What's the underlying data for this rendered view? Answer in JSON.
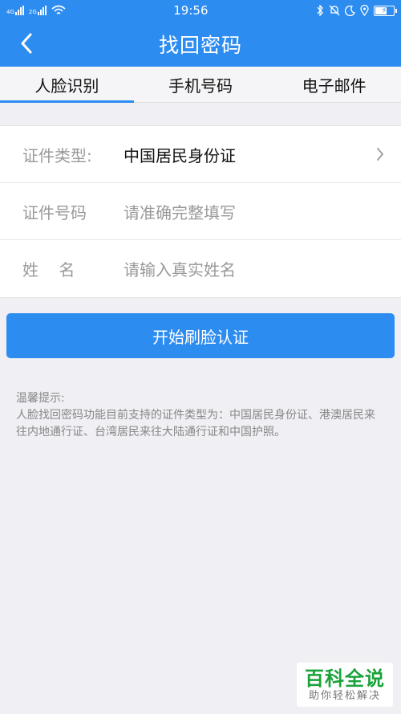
{
  "status_bar": {
    "signal_1": "4G",
    "signal_2": "2G",
    "time": "19:56",
    "icons": [
      "bluetooth-icon",
      "mute-icon",
      "moon-icon",
      "location-icon",
      "battery-charging-icon"
    ]
  },
  "header": {
    "back_icon": "chevron-left-icon",
    "title": "找回密码"
  },
  "tabs": [
    {
      "label": "人脸识别",
      "active": true
    },
    {
      "label": "手机号码",
      "active": false
    },
    {
      "label": "电子邮件",
      "active": false
    }
  ],
  "form": {
    "id_type_label": "证件类型:",
    "id_type_value": "中国居民身份证",
    "id_number_label": "证件号码",
    "id_number_placeholder": "请准确完整填写",
    "name_label": "姓    名",
    "name_placeholder": "请输入真实姓名"
  },
  "primary_button": {
    "label": "开始刷脸认证"
  },
  "tips": {
    "title": "温馨提示:",
    "body": "人脸找回密码功能目前支持的证件类型为：中国居民身份证、港澳居民来往内地通行证、台湾居民来往大陆通行证和中国护照。"
  },
  "watermark": {
    "title": "百科全说",
    "subtitle": "助你轻松解决"
  },
  "colors": {
    "primary": "#2d8cf0",
    "background": "#efeff4",
    "label_gray": "#999999",
    "watermark_green": "#1aa33a"
  }
}
